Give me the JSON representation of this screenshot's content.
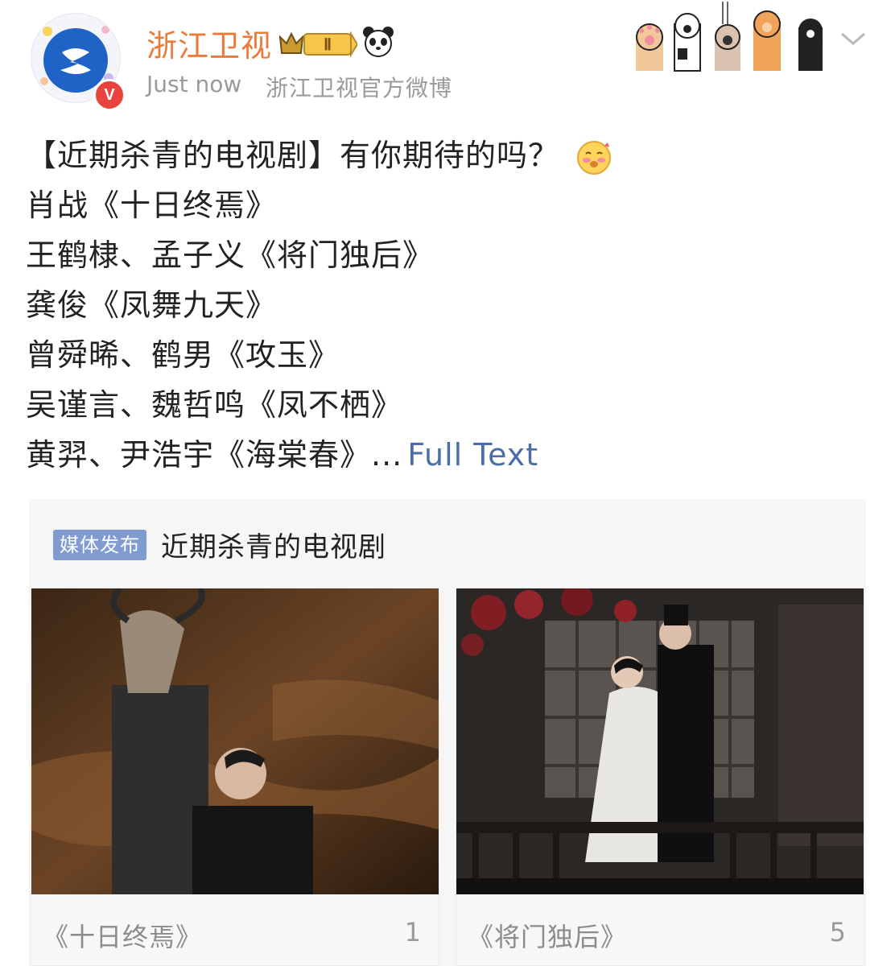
{
  "post": {
    "author": "浙江卫视",
    "time": "Just now",
    "source": "浙江卫视官方微博",
    "badge_level": "Ⅱ",
    "lines": [
      "【近期杀青的电视剧】有你期待的吗？",
      "肖战《十日终焉》",
      "王鹤棣、孟子义《将门独后》",
      "龚俊《凤舞九天》",
      "曾舜晞、鹤男《攻玉》",
      "吴谨言、魏哲鸣《凤不栖》",
      "黄羿、尹浩宇《海棠春》..."
    ],
    "full_text_link": "Full Text"
  },
  "card": {
    "tag": "媒体发布",
    "title": "近期杀青的电视剧",
    "items": [
      {
        "caption": "《十日终焉》",
        "count": "1"
      },
      {
        "caption": "《将门独后》",
        "count": "5"
      }
    ]
  },
  "icons": {
    "avatar": "zhejiang-tv-logo",
    "verified": "verified-v-icon",
    "vip": "crown-badge-icon",
    "panda": "panda-icon",
    "paws": "cat-paws-decoration",
    "menu": "chevron-down-icon",
    "emoji": "blushing-face-emoji"
  },
  "colors": {
    "author": "#ea7b3a",
    "link": "#4b6ea9",
    "tag_bg": "#7f9bd0",
    "verified": "#e8443d"
  }
}
